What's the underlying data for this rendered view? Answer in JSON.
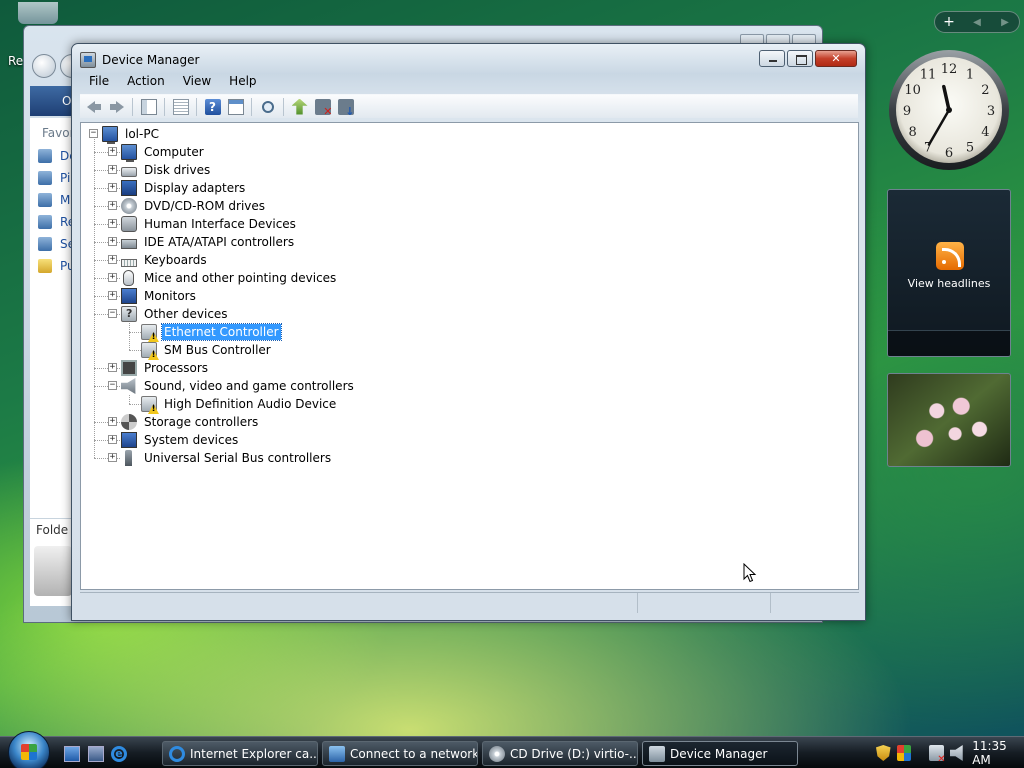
{
  "desktop": {
    "label_partial": "Re"
  },
  "back_window": {
    "address_partial": "O",
    "favorites_partial": "Favor",
    "items": [
      {
        "label": "De",
        "icon": "document-icon"
      },
      {
        "label": "Pi",
        "icon": "pictures-icon"
      },
      {
        "label": "M",
        "icon": "music-icon"
      },
      {
        "label": "Re",
        "icon": "recent-icon"
      },
      {
        "label": "Se",
        "icon": "search-icon"
      },
      {
        "label": "Pu",
        "icon": "folder-icon"
      }
    ],
    "folders_partial": "Folde"
  },
  "device_manager": {
    "title": "Device Manager",
    "menu": [
      "File",
      "Action",
      "View",
      "Help"
    ],
    "toolbar": [
      {
        "name": "back",
        "icon": "arrow-left"
      },
      {
        "name": "forward",
        "icon": "arrow-right"
      },
      {
        "name": "show-hide-console-tree",
        "icon": "pane"
      },
      {
        "name": "properties",
        "icon": "props"
      },
      {
        "name": "help",
        "icon": "help"
      },
      {
        "name": "view",
        "icon": "view"
      },
      {
        "name": "scan-hardware",
        "icon": "scan"
      },
      {
        "name": "update-driver",
        "icon": "update"
      },
      {
        "name": "uninstall",
        "icon": "uninstall"
      },
      {
        "name": "disable",
        "icon": "disable"
      }
    ],
    "tree": {
      "root": "lol-PC",
      "categories": [
        {
          "label": "Computer",
          "icon": "pc",
          "expanded": false
        },
        {
          "label": "Disk drives",
          "icon": "disk",
          "expanded": false
        },
        {
          "label": "Display adapters",
          "icon": "display",
          "expanded": false
        },
        {
          "label": "DVD/CD-ROM drives",
          "icon": "dvd",
          "expanded": false
        },
        {
          "label": "Human Interface Devices",
          "icon": "hid",
          "expanded": false
        },
        {
          "label": "IDE ATA/ATAPI controllers",
          "icon": "ide",
          "expanded": false
        },
        {
          "label": "Keyboards",
          "icon": "kbd",
          "expanded": false
        },
        {
          "label": "Mice and other pointing devices",
          "icon": "mouse",
          "expanded": false
        },
        {
          "label": "Monitors",
          "icon": "monitor",
          "expanded": false
        },
        {
          "label": "Other devices",
          "icon": "other",
          "expanded": true,
          "children": [
            {
              "label": "Ethernet Controller",
              "icon": "warn",
              "selected": true
            },
            {
              "label": "SM Bus Controller",
              "icon": "warn",
              "selected": false
            }
          ]
        },
        {
          "label": "Processors",
          "icon": "cpu",
          "expanded": false
        },
        {
          "label": "Sound, video and game controllers",
          "icon": "sound",
          "expanded": true,
          "children": [
            {
              "label": "High Definition Audio Device",
              "icon": "warn",
              "selected": false
            }
          ]
        },
        {
          "label": "Storage controllers",
          "icon": "storage",
          "expanded": false
        },
        {
          "label": "System devices",
          "icon": "system",
          "expanded": false
        },
        {
          "label": "Universal Serial Bus controllers",
          "icon": "usb",
          "expanded": false
        }
      ]
    }
  },
  "sidebar": {
    "add_label": "+",
    "clock_numbers": [
      "12",
      "1",
      "2",
      "3",
      "4",
      "5",
      "6",
      "7",
      "8",
      "9",
      "10",
      "11"
    ],
    "clock_time": {
      "hour": 11,
      "minute": 35
    },
    "feed_caption": "View headlines"
  },
  "taskbar": {
    "buttons": [
      {
        "label": "Internet Explorer ca...",
        "icon": "ie-icon",
        "active": false
      },
      {
        "label": "Connect to a network",
        "icon": "net-icon",
        "active": false
      },
      {
        "label": "CD Drive (D:) virtio-...",
        "icon": "cd-icon",
        "active": false
      },
      {
        "label": "Device Manager",
        "icon": "dm-icon",
        "active": true
      }
    ],
    "clock": "11:35 AM"
  }
}
